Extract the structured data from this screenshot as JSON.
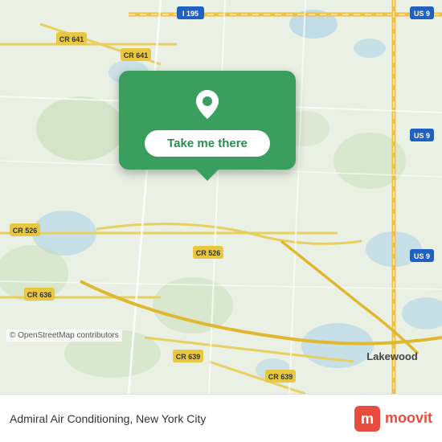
{
  "map": {
    "alt": "OpenStreetMap of Admiral Air Conditioning location",
    "copyright": "© OpenStreetMap contributors"
  },
  "popup": {
    "button_label": "Take me there"
  },
  "info_bar": {
    "location_name": "Admiral Air Conditioning, New York City"
  },
  "moovit": {
    "logo_text": "moovit"
  }
}
